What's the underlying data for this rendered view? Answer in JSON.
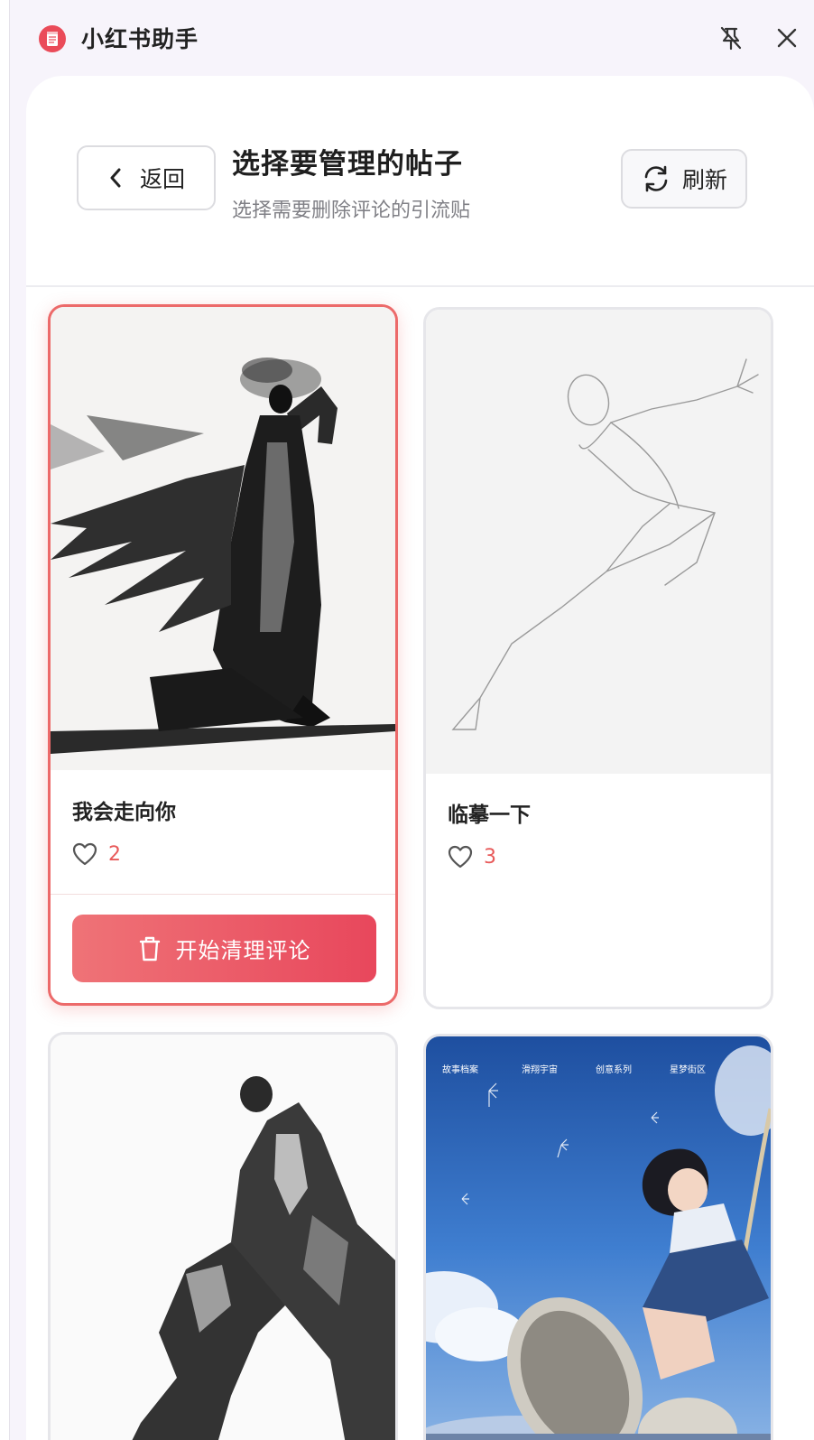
{
  "app": {
    "title": "小红书助手"
  },
  "header": {
    "back_label": "返回",
    "title": "选择要管理的帖子",
    "subtitle": "选择需要删除评论的引流贴",
    "refresh_label": "刷新"
  },
  "posts": [
    {
      "title": "我会走向你",
      "likes": "2",
      "selected": true,
      "action_label": "开始清理评论"
    },
    {
      "title": "临摹一下",
      "likes": "3",
      "selected": false
    },
    {
      "title": "",
      "likes": "",
      "selected": false
    },
    {
      "title": "",
      "likes": "",
      "selected": false,
      "image_text": [
        "故事档案",
        "滑翔宇宙",
        "创意系列",
        "星梦街区"
      ]
    }
  ],
  "colors": {
    "accent": "#e8475c",
    "accent_light": "#ef7377",
    "like_count": "#e85a5a",
    "selected_border": "#ec6a6a"
  },
  "icons": {
    "logo": "notebook-icon",
    "pin": "unpin-icon",
    "close": "close-icon",
    "back": "chevron-left-icon",
    "refresh": "refresh-icon",
    "like": "heart-icon",
    "trash": "trash-icon"
  }
}
